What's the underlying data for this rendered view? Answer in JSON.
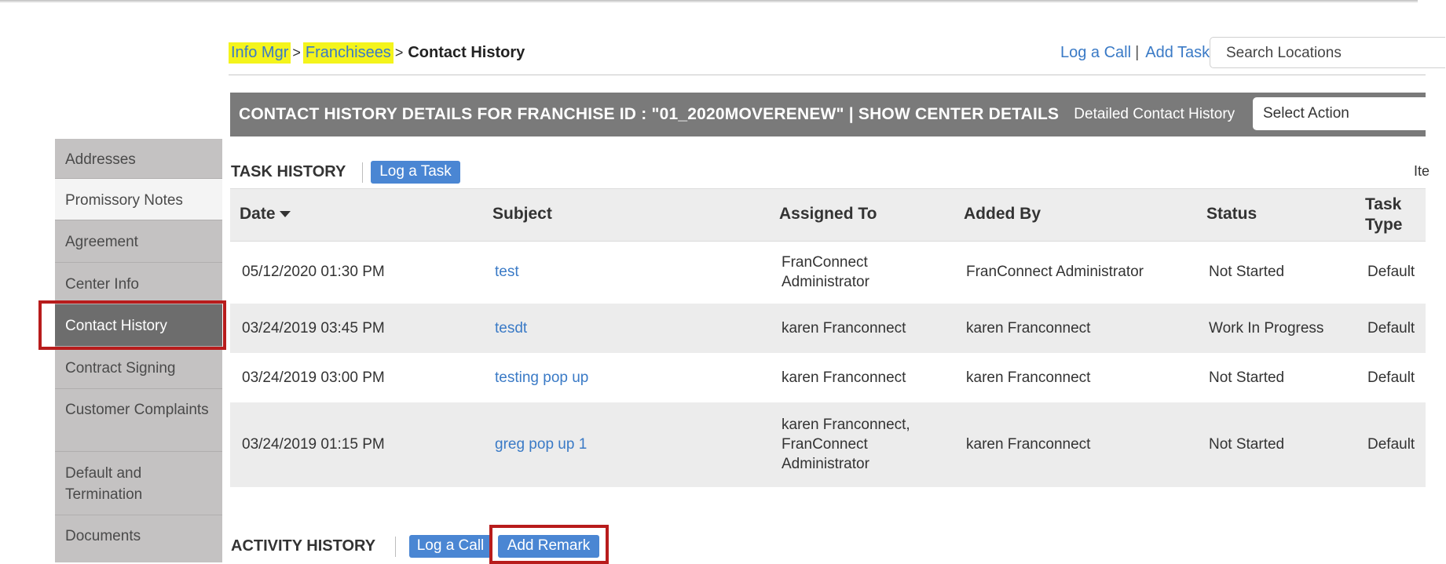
{
  "breadcrumb": {
    "items": [
      "Info Mgr",
      "Franchisees"
    ],
    "separator": ">",
    "current": "Contact History"
  },
  "top_actions": {
    "log_call": "Log a Call",
    "divider": "|",
    "add_task": "Add Task",
    "search_placeholder": "Search Locations"
  },
  "title_bar": {
    "title": "CONTACT HISTORY DETAILS FOR FRANCHISE ID : \"01_2020MOVERENEW\" | SHOW CENTER DETAILS",
    "subtitle": "Detailed Contact History",
    "select_action": "Select Action"
  },
  "sidebar": {
    "items": [
      {
        "label": "Addresses"
      },
      {
        "label": "Promissory Notes"
      },
      {
        "label": "Agreement"
      },
      {
        "label": "Center Info"
      },
      {
        "label": "Contact History"
      },
      {
        "label": "Contract Signing"
      },
      {
        "label": "Customer Complaints"
      },
      {
        "label": "Default and Termination"
      },
      {
        "label": "Documents"
      }
    ]
  },
  "task_history": {
    "title": "TASK HISTORY",
    "log_task_button": "Log a Task",
    "items_label": "Ite",
    "columns": [
      "Date",
      "Subject",
      "Assigned To",
      "Added By",
      "Status",
      "Task Type"
    ],
    "rows": [
      {
        "date": "05/12/2020 01:30 PM",
        "subject": "test",
        "assigned_to": "FranConnect Administrator",
        "added_by": "FranConnect Administrator",
        "status": "Not Started",
        "task_type": "Default"
      },
      {
        "date": "03/24/2019 03:45 PM",
        "subject": "tesdt",
        "assigned_to": "karen Franconnect",
        "added_by": "karen Franconnect",
        "status": "Work In Progress",
        "task_type": "Default"
      },
      {
        "date": "03/24/2019 03:00 PM",
        "subject": "testing pop up",
        "assigned_to": "karen Franconnect",
        "added_by": "karen Franconnect",
        "status": "Not Started",
        "task_type": "Default"
      },
      {
        "date": "03/24/2019 01:15 PM",
        "subject": "greg pop up 1",
        "assigned_to": "karen Franconnect, FranConnect Administrator",
        "added_by": "karen Franconnect",
        "status": "Not Started",
        "task_type": "Default"
      }
    ]
  },
  "activity_history": {
    "title": "ACTIVITY HISTORY",
    "log_call_button": "Log a Call",
    "add_remark_button": "Add Remark"
  }
}
